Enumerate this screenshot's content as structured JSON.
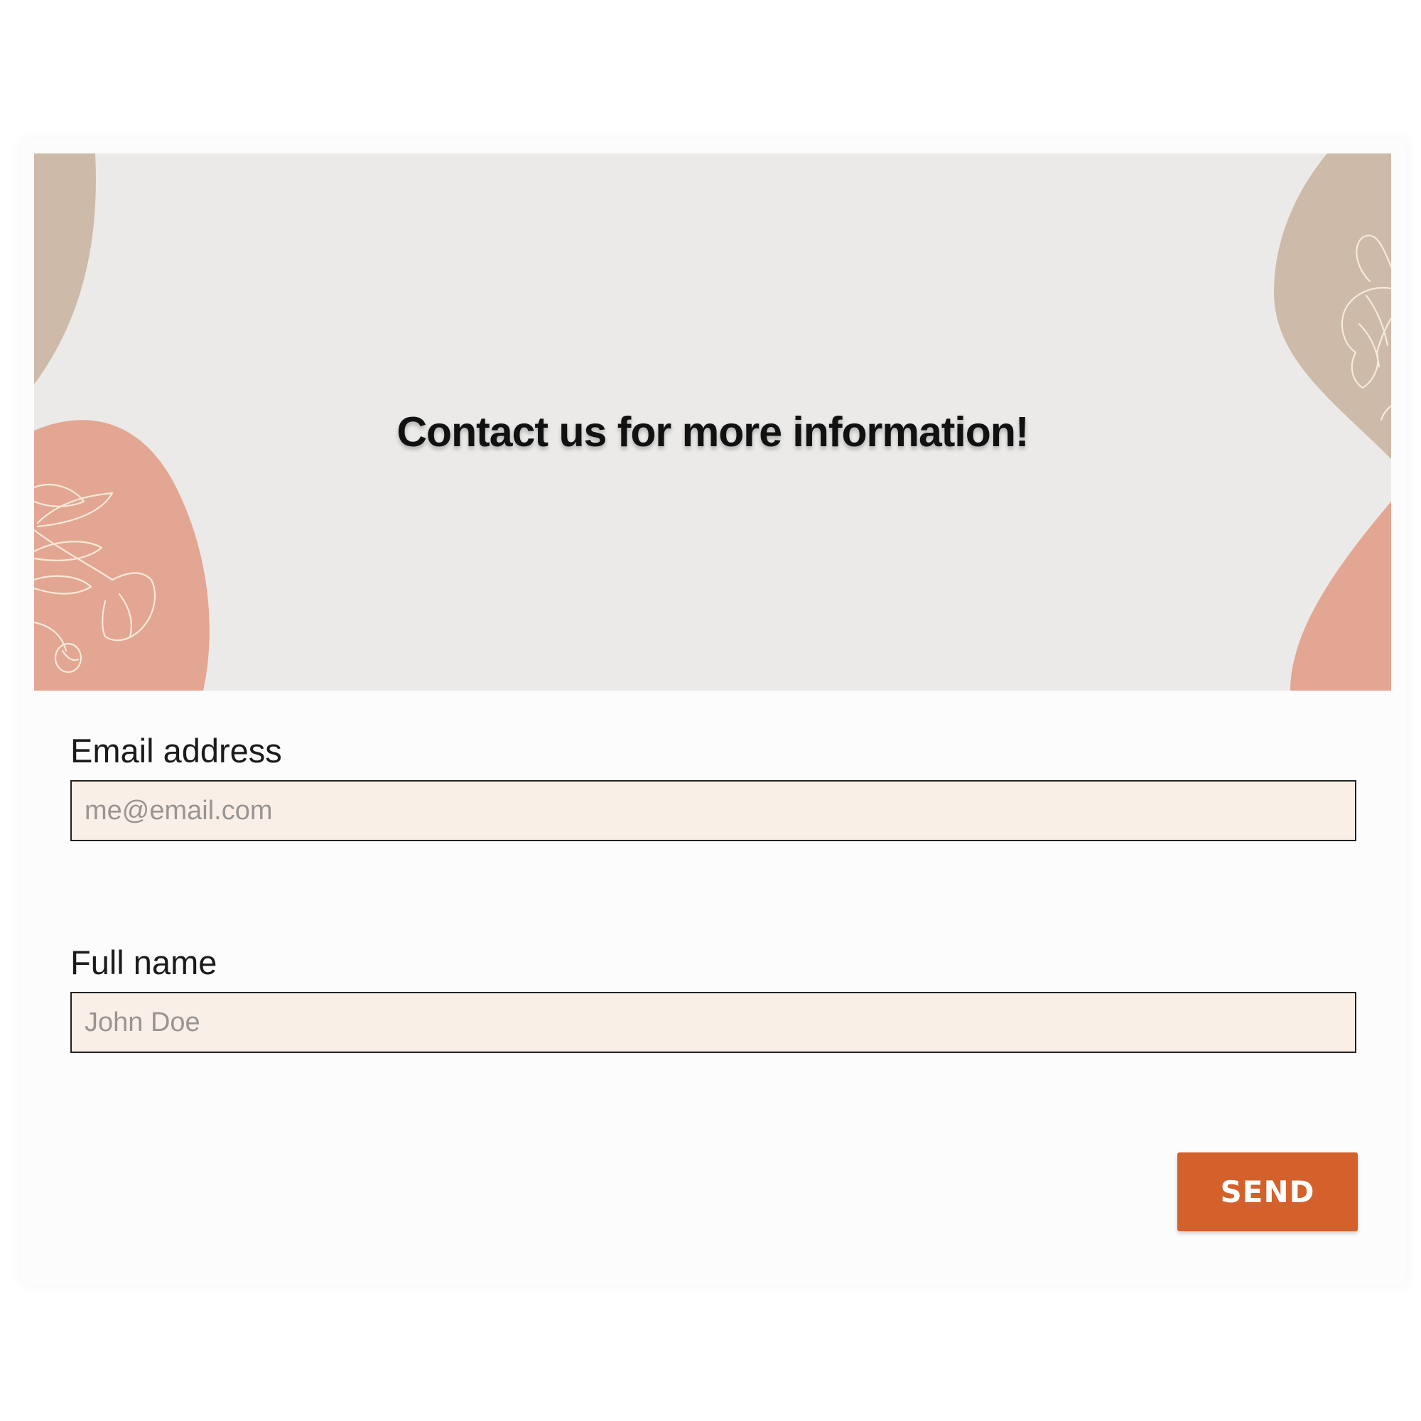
{
  "banner": {
    "title": "Contact us for more information!",
    "colors": {
      "background": "#ebeae8",
      "taupe_blob": "#cdbaa9",
      "salmon_blob": "#e3a693",
      "line_art": "#f6ead8"
    },
    "decorations": [
      "taupe-blob",
      "salmon-blob",
      "flower-line-art"
    ]
  },
  "form": {
    "email": {
      "label": "Email address",
      "placeholder": "me@email.com",
      "value": ""
    },
    "name": {
      "label": "Full name",
      "placeholder": "John Doe",
      "value": ""
    },
    "submit_label": "SEND"
  },
  "colors": {
    "input_background": "#f9efe7",
    "input_border": "#222222",
    "accent": "#d4612b"
  }
}
